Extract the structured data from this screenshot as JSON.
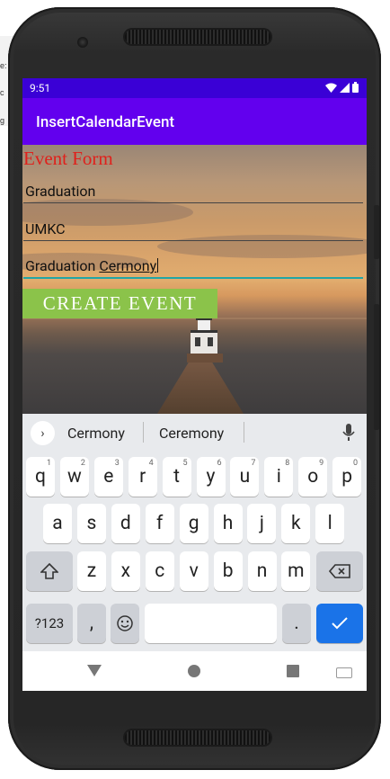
{
  "status_bar": {
    "time": "9:51"
  },
  "app_bar": {
    "title": "InsertCalendarEvent"
  },
  "form": {
    "title": "Event Form",
    "field1_value": "Graduation",
    "field2_value": "UMKC",
    "field3_prefix": "Graduation",
    "field3_word": "Cermony",
    "create_button_label": "CREATE EVENT"
  },
  "keyboard": {
    "suggestions": [
      "Cermony",
      "Ceremony"
    ],
    "row1": [
      {
        "k": "q",
        "h": "1"
      },
      {
        "k": "w",
        "h": "2"
      },
      {
        "k": "e",
        "h": "3"
      },
      {
        "k": "r",
        "h": "4"
      },
      {
        "k": "t",
        "h": "5"
      },
      {
        "k": "y",
        "h": "6"
      },
      {
        "k": "u",
        "h": "7"
      },
      {
        "k": "i",
        "h": "8"
      },
      {
        "k": "o",
        "h": "9"
      },
      {
        "k": "p",
        "h": "0"
      }
    ],
    "row2": [
      "a",
      "s",
      "d",
      "f",
      "g",
      "h",
      "j",
      "k",
      "l"
    ],
    "row3": [
      "z",
      "x",
      "c",
      "v",
      "b",
      "n",
      "m"
    ],
    "symbols_key": "?123",
    "comma_key": ",",
    "period_key": "."
  },
  "colors": {
    "status_bar": "#3a00d6",
    "app_bar": "#6200ee",
    "form_title": "#e0201b",
    "create_button": "#8bc34a",
    "enter_key": "#1a73e8",
    "focus_underline": "#22a6a6"
  },
  "icons": [
    "wifi-icon",
    "signal-icon",
    "battery-icon",
    "expand-suggestions-icon",
    "mic-icon",
    "shift-icon",
    "backspace-icon",
    "emoji-icon",
    "enter-check-icon",
    "nav-back-icon",
    "nav-home-icon",
    "nav-recents-icon",
    "keyboard-switch-icon"
  ]
}
